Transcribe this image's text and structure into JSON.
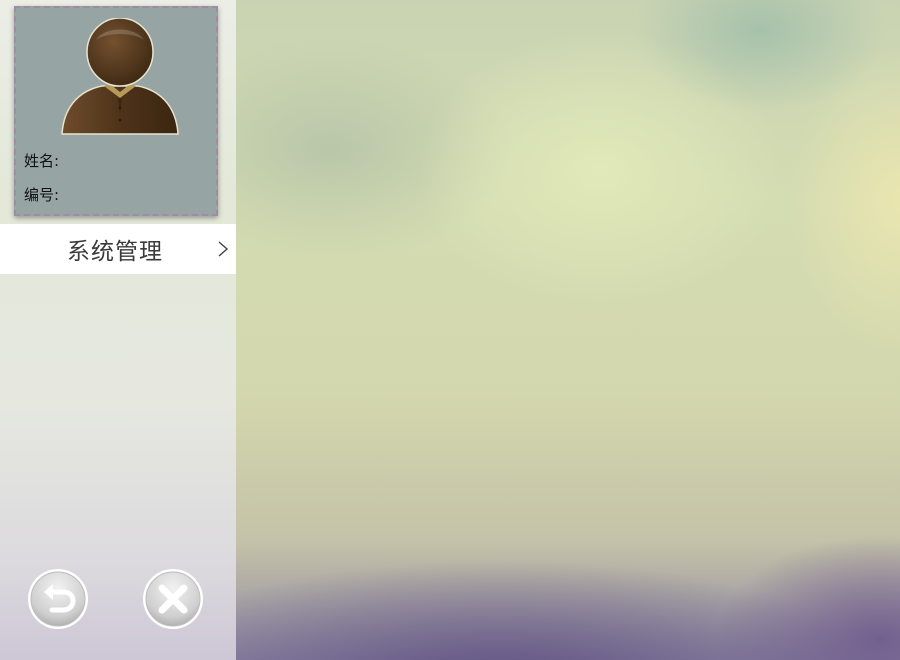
{
  "profile": {
    "name_label": "姓名:",
    "id_label": "编号:"
  },
  "menu": {
    "items": [
      {
        "label": "系统管理",
        "icon": "chevron-right-icon"
      }
    ]
  },
  "actions": {
    "back_icon": "undo-arrow-icon",
    "close_icon": "close-x-icon"
  },
  "colors": {
    "card_background": "#96a4a3",
    "card_border": "#a08aa6",
    "avatar_brown": "#5a3c22",
    "menu_background": "#ffffff"
  }
}
